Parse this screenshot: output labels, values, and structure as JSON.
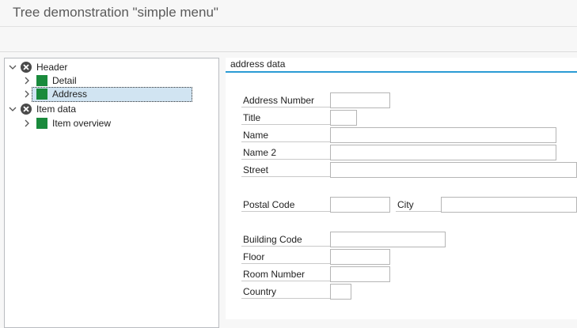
{
  "window": {
    "title": "Tree demonstration \"simple menu\""
  },
  "tree": {
    "nodes": [
      {
        "label": "Header",
        "type": "folder",
        "expanded": true,
        "icon": "close-circle-icon"
      },
      {
        "label": "Detail",
        "type": "leaf",
        "icon": "green-square-icon"
      },
      {
        "label": "Address",
        "type": "leaf",
        "selected": true,
        "icon": "green-square-icon"
      },
      {
        "label": "Item data",
        "type": "folder",
        "expanded": true,
        "icon": "close-circle-icon"
      },
      {
        "label": "Item overview",
        "type": "leaf",
        "icon": "green-square-icon"
      }
    ]
  },
  "form": {
    "section_title": "address data",
    "fields": {
      "address_number": {
        "label": "Address Number",
        "value": ""
      },
      "title": {
        "label": "Title",
        "value": ""
      },
      "name": {
        "label": "Name",
        "value": ""
      },
      "name2": {
        "label": "Name 2",
        "value": ""
      },
      "street": {
        "label": "Street",
        "value": ""
      },
      "postal_code": {
        "label": "Postal Code",
        "value": ""
      },
      "city": {
        "label": "City",
        "value": ""
      },
      "building_code": {
        "label": "Building Code",
        "value": ""
      },
      "floor": {
        "label": "Floor",
        "value": ""
      },
      "room_number": {
        "label": "Room Number",
        "value": ""
      },
      "country": {
        "label": "Country",
        "value": ""
      }
    }
  },
  "colors": {
    "accent": "#2a9bd4",
    "leaf_icon": "#1a8a3c",
    "selection": "#d1e4f2"
  }
}
